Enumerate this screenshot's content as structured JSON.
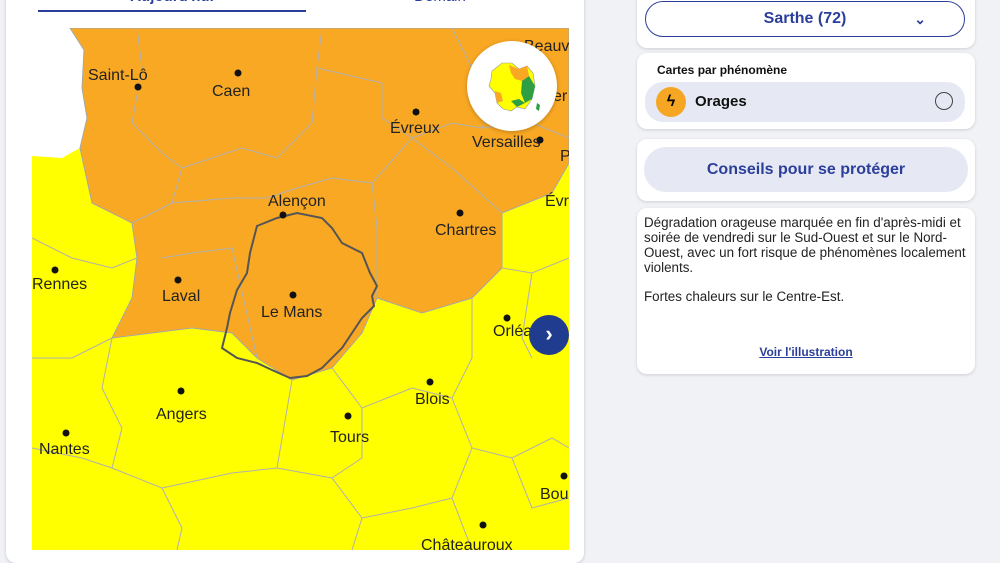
{
  "tabs": [
    {
      "label": "Aujourd'hui",
      "active": true
    },
    {
      "label": "Demain",
      "active": false
    }
  ],
  "map": {
    "alert_colors": {
      "orange": "#f9a823",
      "yellow": "#ffff00"
    },
    "selected_department": "Sarthe",
    "cities": [
      {
        "name": "Saint-Lô",
        "label": "Saint-Lô"
      },
      {
        "name": "Caen",
        "label": "Caen"
      },
      {
        "name": "Évreux",
        "label": "Évreux"
      },
      {
        "name": "Versailles",
        "label": "Versailles"
      },
      {
        "name": "Alençon",
        "label": "Alençon"
      },
      {
        "name": "Chartres",
        "label": "Chartres"
      },
      {
        "name": "Rennes",
        "label": "Rennes"
      },
      {
        "name": "Laval",
        "label": "Laval"
      },
      {
        "name": "Le Mans",
        "label": "Le Mans"
      },
      {
        "name": "Orléans",
        "label": "Orléa"
      },
      {
        "name": "Angers",
        "label": "Angers"
      },
      {
        "name": "Blois",
        "label": "Blois"
      },
      {
        "name": "Tours",
        "label": "Tours"
      },
      {
        "name": "Nantes",
        "label": "Nantes"
      },
      {
        "name": "Bourges",
        "label": "Bou"
      },
      {
        "name": "Châteauroux",
        "label": "Châteauroux"
      }
    ],
    "edge_labels": [
      "Beauva",
      "Évr",
      "P",
      "er"
    ],
    "mini_map_icon": "france-vigilance-mini-map",
    "next_icon": "chevron-right-icon"
  },
  "department_select": {
    "value": "Sarthe (72)",
    "icon": "chevron-down-icon"
  },
  "phenomena": {
    "title": "Cartes par phénomène",
    "items": [
      {
        "label": "Orages",
        "icon": "storm-icon",
        "selected": false
      }
    ]
  },
  "advice_button": "Conseils pour se protéger",
  "bulletin": {
    "paragraphs": [
      "Dégradation orageuse marquée en fin d'après-midi et soirée de vendredi sur le Sud-Ouest et sur le Nord-Ouest, avec un fort risque de phénomènes localement violents.",
      "Fortes chaleurs sur le Centre-Est."
    ],
    "link": "Voir l'illustration"
  }
}
